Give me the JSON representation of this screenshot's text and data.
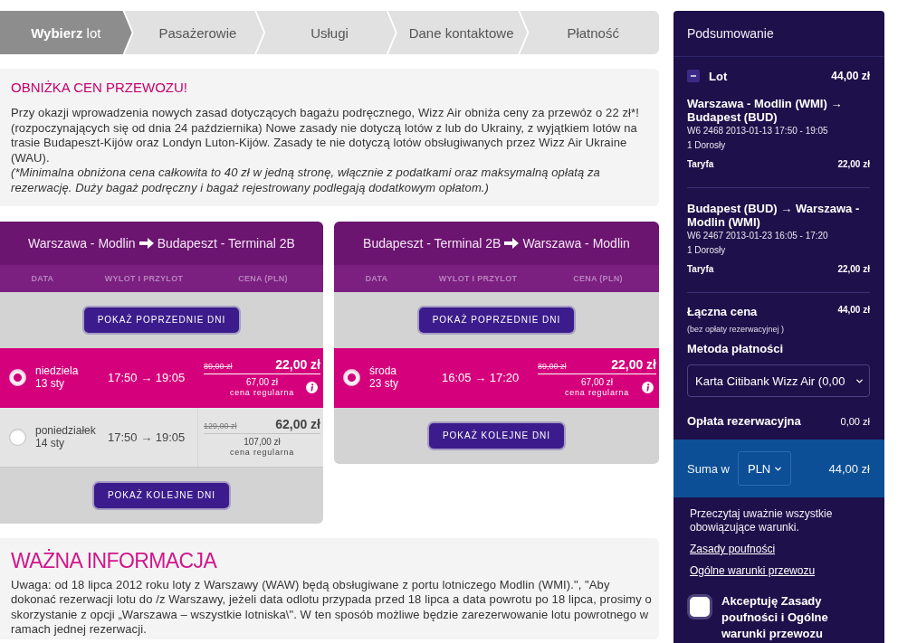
{
  "steps": [
    {
      "label": "**Wybierz** lot",
      "selected": true
    },
    {
      "label": "Pasażerowie",
      "selected": false
    },
    {
      "label": "Usługi",
      "selected": false
    },
    {
      "label": "Dane kontaktowe",
      "selected": false
    },
    {
      "label": "Płatność",
      "selected": false
    }
  ],
  "notice": {
    "title": "OBNIŻKA CEN PRZEWOZU!",
    "text": "Przy okazji wprowadzenia nowych zasad dotyczących bagażu podręcznego, Wizz Air obniża ceny za przewóz o 22 zł*! (rozpoczynających się od dnia 24 października) Nowe zasady nie dotyczą lotów z lub do Ukrainy, z wyjątkiem lotów na trasie Budapeszt-Kijów oraz Londyn Luton-Kijów. Zasady te nie dotyczą lotów obsługiwanych przez Wizz Air Ukraine (WAU).",
    "footnote": "(*Minimalna obniżona cena całkowita to 40 zł w jedną stronę, włącznie z podatkami oraz maksymalną opłatą za rezerwację. Duży bagaż podręczny i bagaż rejestrowany podlegają dodatkowym opłatom.)"
  },
  "flights": [
    {
      "from": "Warszawa - Modlin",
      "to": "Budapeszt - Terminal 2B",
      "columns": [
        "DATA",
        "WYLOT I PRZYLOT",
        "CENA (PLN)"
      ],
      "previous_button": "POKAŻ POPRZEDNIE DNI",
      "next_button": "POKAŻ KOLEJNE DNI",
      "rows": [
        {
          "selected": true,
          "day": "niedziela",
          "date": "13 sty",
          "times": "17:50 → 19:05",
          "old_price": "89,00 zł",
          "price": "22,00 zł",
          "regular_price": "67,00 zł",
          "regular_label": "cena regularna",
          "info": true
        },
        {
          "selected": false,
          "day": "poniedziałek",
          "date": "14 sty",
          "times": "17:50 → 19:05",
          "old_price": "129,00 zł",
          "price": "62,00 zł",
          "regular_price": "107,00 zł",
          "regular_label": "cena regularna",
          "info": false
        }
      ]
    },
    {
      "from": "Budapeszt - Terminal 2B",
      "to": "Warszawa - Modlin",
      "columns": [
        "DATA",
        "WYLOT I PRZYLOT",
        "CENA (PLN)"
      ],
      "previous_button": "POKAŻ POPRZEDNIE DNI",
      "next_button": "POKAŻ KOLEJNE DNI",
      "rows": [
        {
          "selected": true,
          "day": "środa",
          "date": "23 sty",
          "times": "16:05 → 17:20",
          "old_price": "89,00 zł",
          "price": "22,00 zł",
          "regular_price": "67,00 zł",
          "regular_label": "cena regularna",
          "info": true
        }
      ]
    }
  ],
  "info": {
    "title": "WAŻNA INFORMACJA",
    "text": "Uwaga: od 18 lipca 2012 roku loty z Warszawy (WAW) będą obsługiwane z portu lotniczego Modlin (WMI).\", \"Aby dokonać rezerwacji lotu do /z Warszawy, jeżeli data odlotu przypada przed 18 lipca a data powrotu po 18 lipca, prosimy o skorzystanie z opcji „Warszawa – wszystkie lotniska\\\". W ten sposób możliwe będzie zarezerwowanie lotu powrotnego w ramach jednej rezerwacji."
  },
  "summary": {
    "title": "Podsumowanie",
    "flight_label": "Lot",
    "flight_total": "44,00 zł",
    "expanded": true,
    "legs": [
      {
        "route": "Warszawa - Modlin (WMI) → Budapest (BUD)",
        "details": "W6 2468 2013-01-13 17:50 - 19:05",
        "passengers": "1 Dorosły",
        "fare_label": "Taryfa",
        "fare": "22,00 zł"
      },
      {
        "route": "Budapest (BUD) → Warszawa - Modlin (WMI)",
        "details": "W6 2467 2013-01-23 16:05 - 17:20",
        "passengers": "1 Dorosły",
        "fare_label": "Taryfa",
        "fare": "22,00 zł"
      }
    ],
    "total_label": "Łączna cena",
    "total": "44,00 zł",
    "total_note": "(bez opłaty rezerwacyjnej )",
    "payment_label": "Metoda płatności",
    "payment_value": "Karta Citibank Wizz Air (0,00",
    "fee_label": "Opłata rezerwacyjna",
    "fee": "0,00 zł",
    "sum_label": "Suma w",
    "currency": "PLN",
    "sum": "44,00 zł",
    "terms_text": "Przeczytaj uważnie wszystkie obowiązujące warunki.",
    "links": [
      "Zasady poufności",
      "Ogólne warunki przewozu"
    ],
    "accept": {
      "label": "Akceptuję Zasady poufności i Ogólne warunki przewozu",
      "checked": false
    }
  }
}
